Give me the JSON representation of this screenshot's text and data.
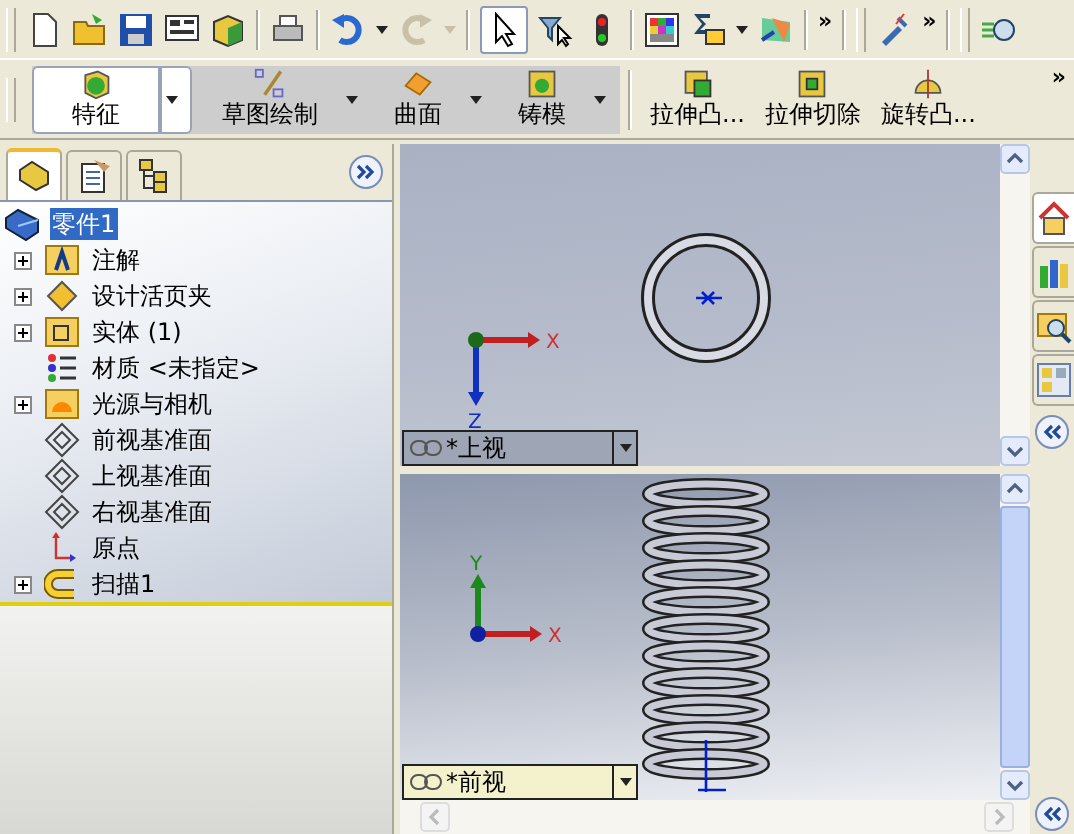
{
  "toolbar": {
    "redo": {
      "disabled": true
    },
    "select": {
      "selected": true
    },
    "more": [
      "»",
      "»"
    ]
  },
  "command_manager": {
    "tabs": [
      {
        "label": "特征",
        "selected": true,
        "kind": "features"
      },
      {
        "label": "草图绘制",
        "selected": false,
        "kind": "sketch"
      },
      {
        "label": "曲面",
        "selected": false,
        "kind": "surfaces"
      },
      {
        "label": "铸模",
        "selected": false,
        "kind": "mold"
      }
    ],
    "commands": [
      {
        "label": "拉伸凸...",
        "kind": "extrude-boss"
      },
      {
        "label": "拉伸切除",
        "kind": "extrude-cut"
      },
      {
        "label": "旋转凸...",
        "kind": "revolve"
      }
    ],
    "more": "»"
  },
  "feature_manager": {
    "tabs": [
      {
        "kind": "feature-tree",
        "selected": true
      },
      {
        "kind": "properties",
        "selected": false
      },
      {
        "kind": "configurations",
        "selected": false
      }
    ],
    "tree": {
      "label": "零件1",
      "selected": true,
      "children": [
        {
          "label": "注解",
          "kind": "annotations",
          "expanded": false
        },
        {
          "label": "设计活页夹",
          "kind": "design-binder",
          "expanded": false
        },
        {
          "label": "实体 (1)",
          "kind": "solid-bodies",
          "expanded": false
        },
        {
          "label": "材质 <未指定>",
          "kind": "material"
        },
        {
          "label": "光源与相机",
          "kind": "lights",
          "expanded": false
        },
        {
          "label": "前视基准面",
          "kind": "plane"
        },
        {
          "label": "上视基准面",
          "kind": "plane"
        },
        {
          "label": "右视基准面",
          "kind": "plane"
        },
        {
          "label": "原点",
          "kind": "origin"
        },
        {
          "label": "扫描1",
          "kind": "sweep",
          "expanded": false
        }
      ]
    }
  },
  "viewports": [
    {
      "kind": "top",
      "view_name": "*上视",
      "active": false,
      "axes": [
        "X",
        "Z"
      ]
    },
    {
      "kind": "front",
      "view_name": "*前视",
      "active": true,
      "axes": [
        "X",
        "Y"
      ]
    }
  ],
  "task_pane": {
    "tabs": [
      {
        "kind": "home",
        "selected": true
      },
      {
        "kind": "library",
        "selected": false
      },
      {
        "kind": "explorer",
        "selected": false
      },
      {
        "kind": "palette",
        "selected": false
      }
    ]
  }
}
